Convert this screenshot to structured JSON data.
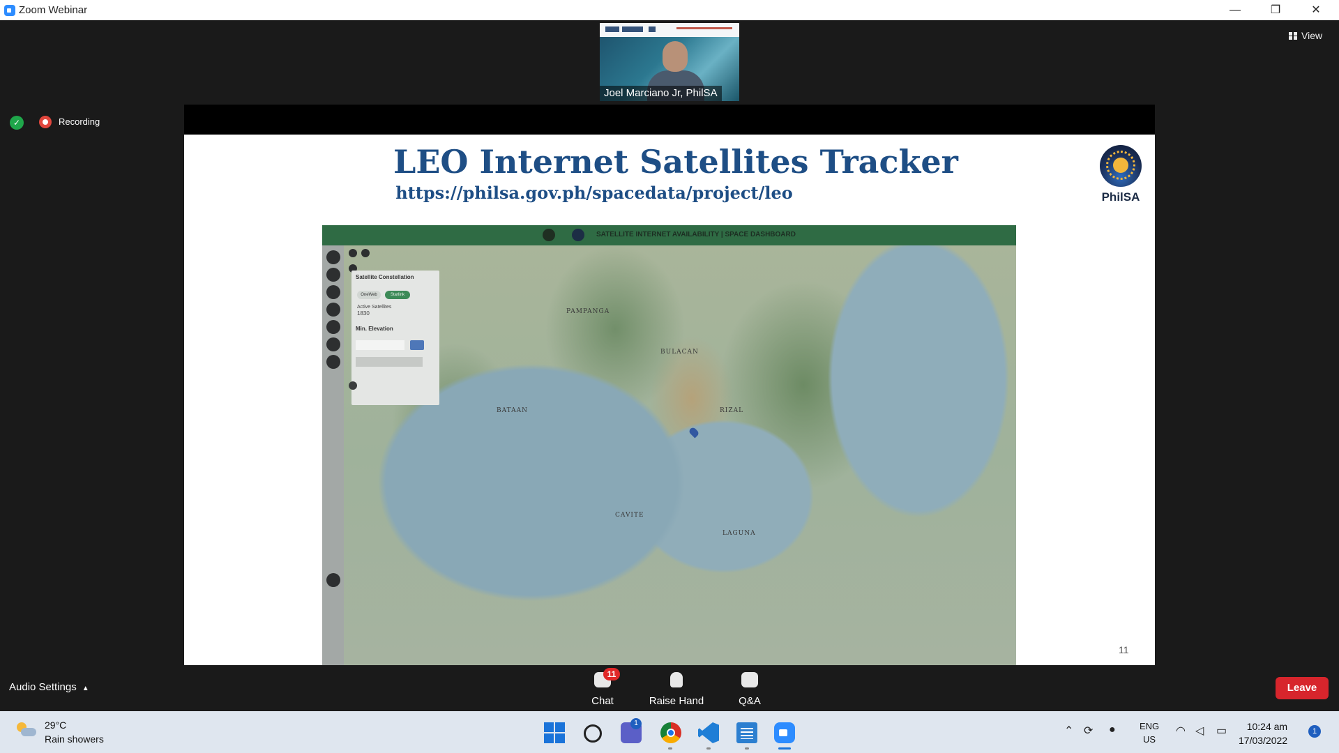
{
  "window": {
    "title": "Zoom Webinar",
    "minimize": "—",
    "restore": "❐",
    "close": "✕"
  },
  "video": {
    "speaker_name": "Joel Marciano Jr, PhilSA"
  },
  "view_button": {
    "label": "View"
  },
  "recording": {
    "label": "Recording"
  },
  "slide": {
    "title": "LEO Internet Satellites Tracker",
    "url": "https://philsa.gov.ph/spacedata/project/leo",
    "logo_text": "PhilSA",
    "page_number": "11"
  },
  "dashboard": {
    "header": "SATELLITE INTERNET AVAILABILITY  |  SPACE DASHBOARD",
    "panel": {
      "title": "Satellite Constellation",
      "option_a": "OneWeb",
      "option_b": "Starlink",
      "active_label": "Active Satellites",
      "active_value": "1830",
      "elevation_label": "Min. Elevation"
    },
    "places": [
      "PAMPANGA",
      "BULACAN",
      "BATAAN",
      "RIZAL",
      "CAVITE",
      "LAGUNA"
    ]
  },
  "controls": {
    "audio_settings": "Audio Settings",
    "chat": "Chat",
    "chat_badge": "11",
    "raise_hand": "Raise Hand",
    "qa": "Q&A",
    "leave": "Leave"
  },
  "taskbar": {
    "temperature": "29°C",
    "condition": "Rain showers",
    "teams_badge": "1",
    "lang_top": "ENG",
    "lang_bottom": "US",
    "time": "10:24 am",
    "date": "17/03/2022",
    "notifications": "1"
  }
}
